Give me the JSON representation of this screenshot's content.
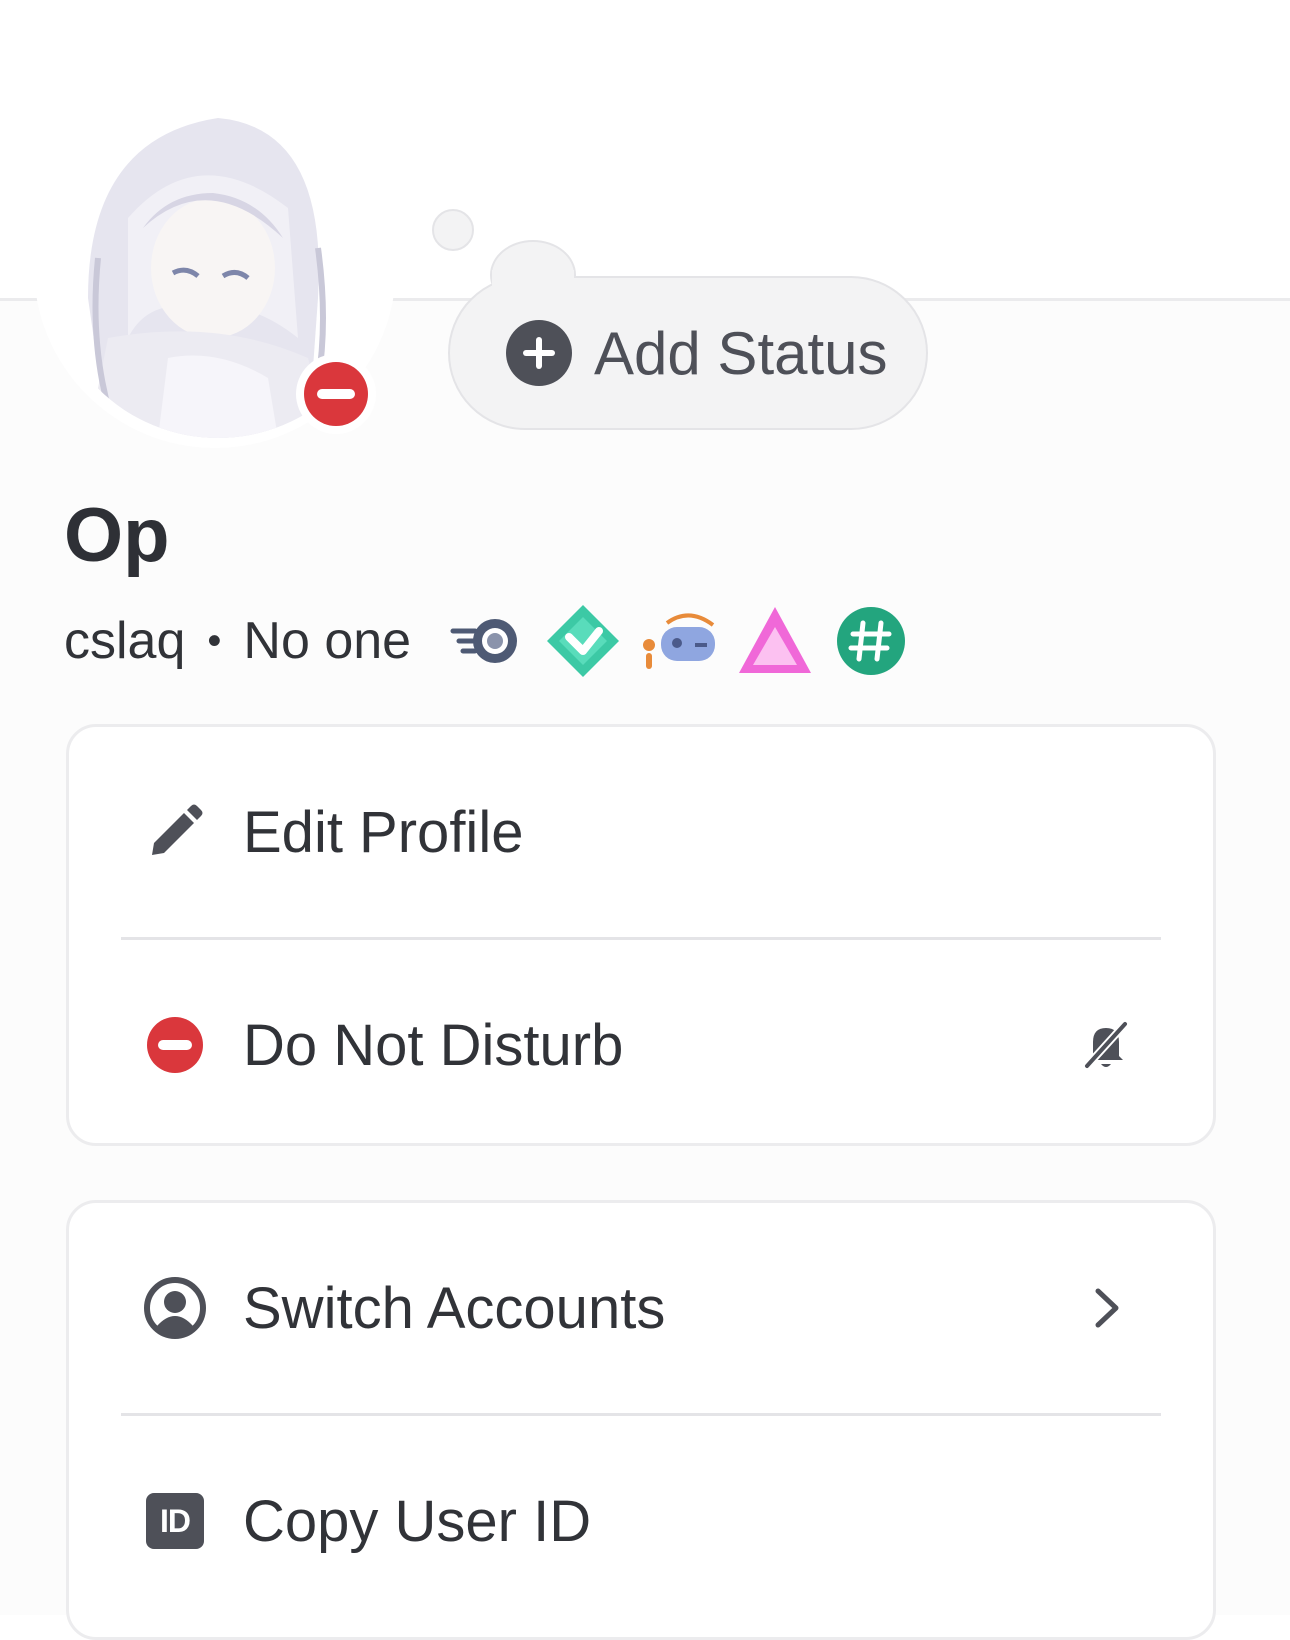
{
  "status": {
    "add_label": "Add Status",
    "icon": "plus-circle-icon"
  },
  "profile": {
    "display_name": "Op",
    "username": "cslaq",
    "separator": "•",
    "pronouns": "No one",
    "presence": "do-not-disturb",
    "badges": [
      "nitro-badge",
      "boost-badge",
      "quest-badge",
      "hypesquad-brilliance-badge",
      "originally-known-as-badge"
    ]
  },
  "menu_card_1": {
    "items": [
      {
        "label": "Edit Profile",
        "icon": "pencil-icon"
      },
      {
        "label": "Do Not Disturb",
        "icon": "dnd-status-icon",
        "trailing_icon": "bell-slash-icon"
      }
    ]
  },
  "menu_card_2": {
    "items": [
      {
        "label": "Switch Accounts",
        "icon": "user-circle-icon",
        "trailing_icon": "chevron-right-icon"
      },
      {
        "label": "Copy User ID",
        "icon": "id-icon",
        "icon_text": "ID"
      }
    ]
  },
  "colors": {
    "dnd_red": "#da373c",
    "icon_gray": "#4e5058",
    "text": "#313338",
    "card_border": "#ececee"
  }
}
